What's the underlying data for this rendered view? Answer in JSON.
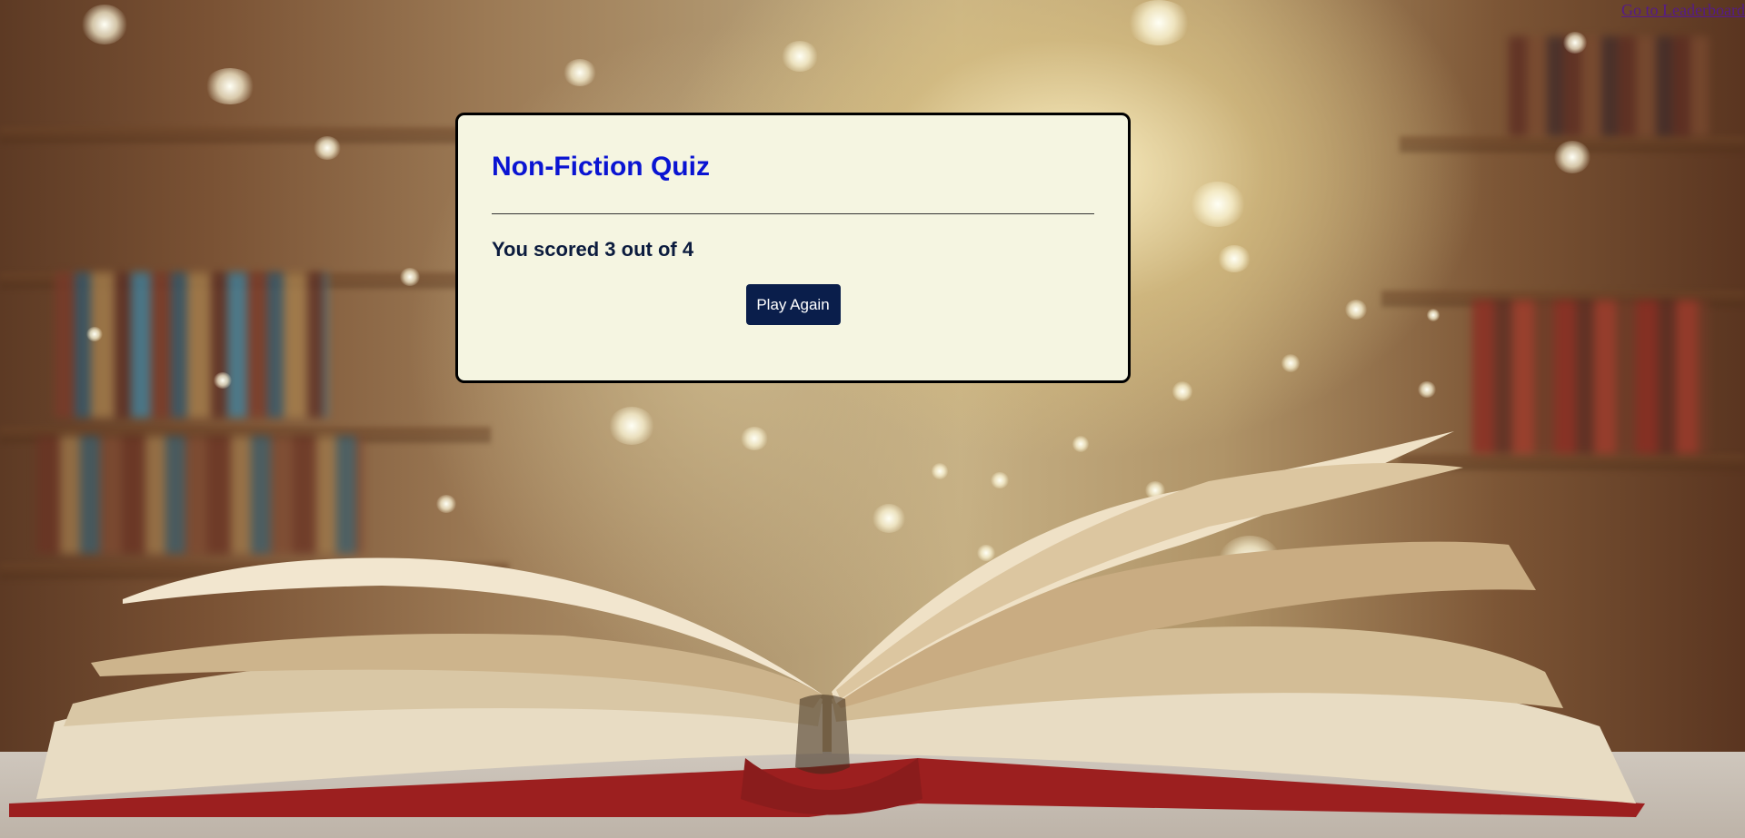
{
  "nav": {
    "leaderboard_link": "Go to Leaderboard"
  },
  "quiz": {
    "title": "Non-Fiction Quiz",
    "score_text": "You scored 3 out of 4",
    "play_again_label": "Play Again"
  },
  "colors": {
    "title": "#0a14d2",
    "button_bg": "#0a1e4b",
    "card_bg": "#f5f5e1",
    "link": "#551a8b"
  }
}
